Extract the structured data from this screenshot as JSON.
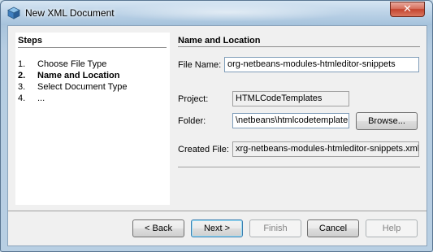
{
  "window": {
    "title": "New XML Document",
    "close_symbol": "✕"
  },
  "steps": {
    "title": "Steps",
    "items": [
      {
        "num": "1.",
        "label": "Choose File Type"
      },
      {
        "num": "2.",
        "label": "Name and Location"
      },
      {
        "num": "3.",
        "label": "Select Document Type"
      },
      {
        "num": "4.",
        "label": "..."
      }
    ],
    "current_index": 1
  },
  "panel": {
    "title": "Name and Location",
    "file_name_label": "File Name:",
    "file_name_value": "org-netbeans-modules-htmleditor-snippets",
    "project_label": "Project:",
    "project_value": "HTMLCodeTemplates",
    "folder_label": "Folder:",
    "folder_value": "\\netbeans\\htmlcodetemplate",
    "browse_label": "Browse...",
    "created_file_label": "Created File:",
    "created_file_value": "xrg-netbeans-modules-htmleditor-snippets.xml"
  },
  "buttons": {
    "back": "< Back",
    "next": "Next >",
    "finish": "Finish",
    "cancel": "Cancel",
    "help": "Help"
  },
  "icons": {
    "app": "netbeans-cube-icon",
    "close": "close-icon"
  },
  "colors": {
    "titlebar": "#bed4e8",
    "close": "#c4452f",
    "dialog_bg": "#f0f0f0"
  }
}
